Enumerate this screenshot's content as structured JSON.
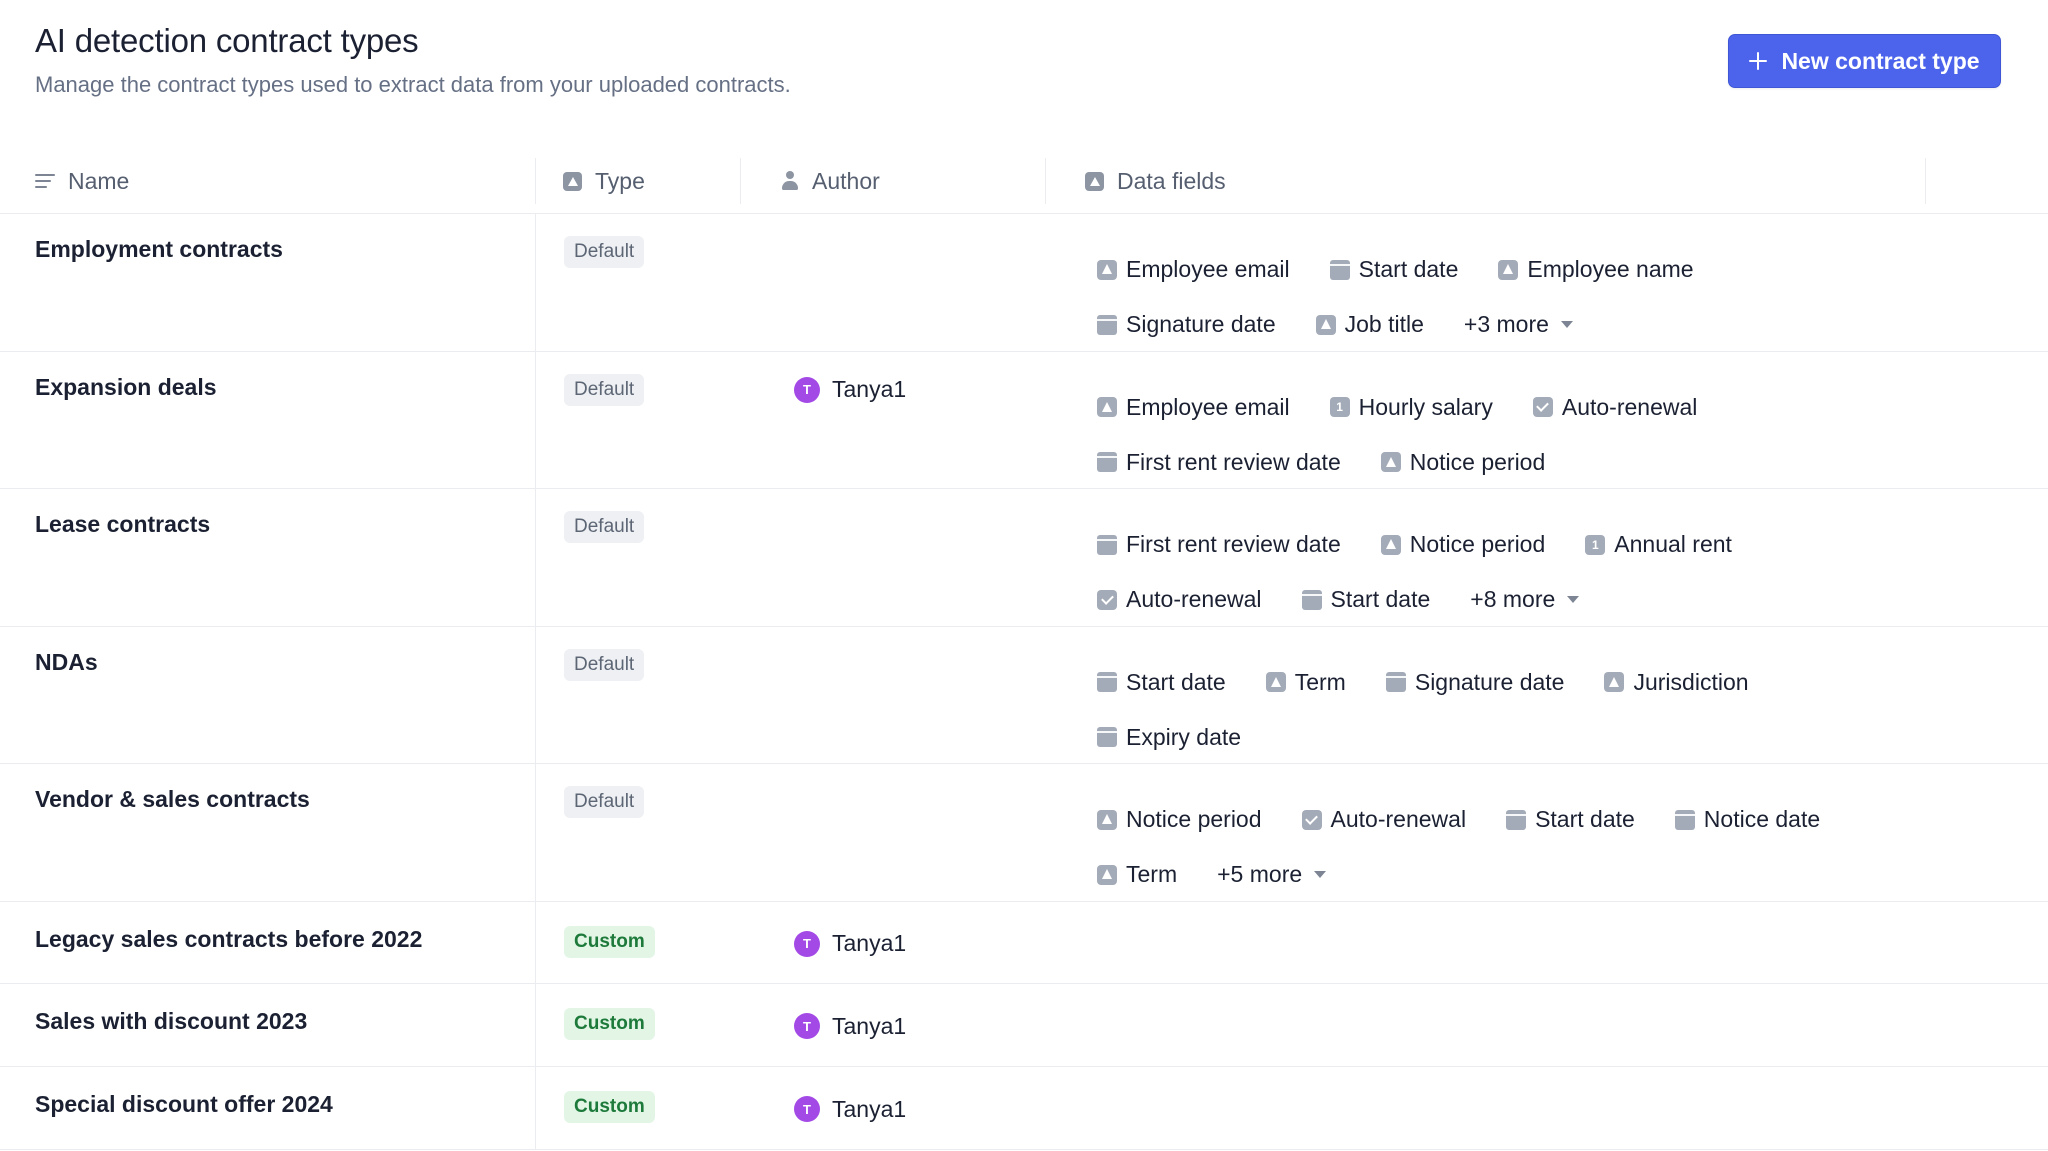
{
  "header": {
    "title": "AI detection contract types",
    "subtitle": "Manage the contract types used to extract data from your uploaded contracts.",
    "new_button": "New contract type"
  },
  "columns": {
    "name": "Name",
    "type": "Type",
    "author": "Author",
    "fields": "Data fields"
  },
  "rows": [
    {
      "name": "Employment contracts",
      "type": "Default",
      "author": "",
      "lines": [
        [
          {
            "icon": "text",
            "label": "Employee email"
          },
          {
            "icon": "date",
            "label": "Start date"
          },
          {
            "icon": "text",
            "label": "Employee name"
          }
        ],
        [
          {
            "icon": "date",
            "label": "Signature date"
          },
          {
            "icon": "text",
            "label": "Job title"
          }
        ]
      ],
      "more": "+3 more"
    },
    {
      "name": "Expansion deals",
      "type": "Default",
      "author": "Tanya1",
      "avatar": "T",
      "lines": [
        [
          {
            "icon": "text",
            "label": "Employee email"
          },
          {
            "icon": "number",
            "label": "Hourly salary"
          },
          {
            "icon": "check",
            "label": "Auto-renewal"
          }
        ],
        [
          {
            "icon": "date",
            "label": "First rent review date"
          },
          {
            "icon": "text",
            "label": "Notice period"
          }
        ]
      ],
      "more": ""
    },
    {
      "name": "Lease contracts",
      "type": "Default",
      "author": "",
      "lines": [
        [
          {
            "icon": "date",
            "label": "First rent review date"
          },
          {
            "icon": "text",
            "label": "Notice period"
          },
          {
            "icon": "number",
            "label": "Annual rent"
          }
        ],
        [
          {
            "icon": "check",
            "label": "Auto-renewal"
          },
          {
            "icon": "date",
            "label": "Start date"
          }
        ]
      ],
      "more": "+8 more"
    },
    {
      "name": "NDAs",
      "type": "Default",
      "author": "",
      "lines": [
        [
          {
            "icon": "date",
            "label": "Start date"
          },
          {
            "icon": "text",
            "label": "Term"
          },
          {
            "icon": "date",
            "label": "Signature date"
          },
          {
            "icon": "text",
            "label": "Jurisdiction"
          }
        ],
        [
          {
            "icon": "date",
            "label": "Expiry date"
          }
        ]
      ],
      "more": ""
    },
    {
      "name": "Vendor & sales contracts",
      "type": "Default",
      "author": "",
      "lines": [
        [
          {
            "icon": "text",
            "label": "Notice period"
          },
          {
            "icon": "check",
            "label": "Auto-renewal"
          },
          {
            "icon": "date",
            "label": "Start date"
          },
          {
            "icon": "date",
            "label": "Notice date"
          }
        ],
        [
          {
            "icon": "text",
            "label": "Term"
          }
        ]
      ],
      "more": "+5 more"
    },
    {
      "name": "Legacy sales contracts before 2022",
      "type": "Custom",
      "author": "Tanya1",
      "avatar": "T",
      "lines": [],
      "more": ""
    },
    {
      "name": "Sales with discount 2023",
      "type": "Custom",
      "author": "Tanya1",
      "avatar": "T",
      "lines": [],
      "more": ""
    },
    {
      "name": "Special discount offer 2024",
      "type": "Custom",
      "author": "Tanya1",
      "avatar": "T",
      "lines": [],
      "more": ""
    }
  ],
  "number_icon_glyph": "1",
  "colors": {
    "accent": "#4c64ec",
    "avatar": "#a349e6",
    "custom_badge_bg": "#e3f6e6",
    "custom_badge_text": "#1d7a3a",
    "default_badge_bg": "#eef0f3"
  }
}
